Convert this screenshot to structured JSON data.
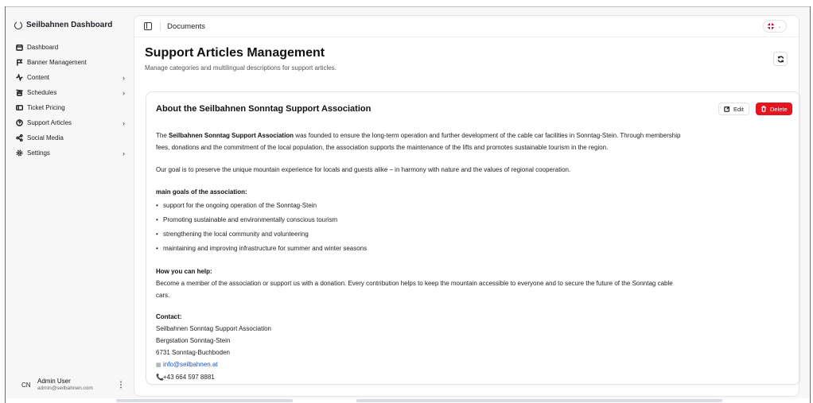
{
  "app": {
    "brand": "Seilbahnen Dashboard"
  },
  "sidebar": {
    "items": [
      {
        "label": "Dashboard",
        "icon": "calendar-icon",
        "has_children": false
      },
      {
        "label": "Banner Management",
        "icon": "flag-icon",
        "has_children": false
      },
      {
        "label": "Content",
        "icon": "activity-icon",
        "has_children": true
      },
      {
        "label": "Schedules",
        "icon": "cable-car-icon",
        "has_children": true
      },
      {
        "label": "Ticket Pricing",
        "icon": "ticket-icon",
        "has_children": false
      },
      {
        "label": "Support Articles",
        "icon": "help-circle-icon",
        "has_children": true
      },
      {
        "label": "Social Media",
        "icon": "share-icon",
        "has_children": false
      },
      {
        "label": "Settings",
        "icon": "gear-icon",
        "has_children": true
      }
    ],
    "chevron": "›",
    "user": {
      "initials": "CN",
      "name": "Admin User",
      "email": "admin@seilbahnen.com",
      "menu_glyph": "⋮"
    }
  },
  "header": {
    "breadcrumb": "Documents",
    "lang_chevron": "⌄"
  },
  "page": {
    "title": "Support Articles Management",
    "subtitle": "Manage categories and multilingual descriptions for support articles."
  },
  "article": {
    "title": "About the Seilbahnen Sonntag Support Association",
    "edit_label": "Edit",
    "delete_label": "Delete",
    "intro_bold": "Seilbahnen Sonntag Support Association",
    "intro_prefix": "The ",
    "intro_rest_1": " was founded to ensure the long-term operation and further development of the cable car facilities in Sonntag-Stein. Through membership",
    "intro_rest_2": "fees, donations and the commitment of the local population, the association supports the maintenance of the lifts and promotes sustainable tourism in the region.",
    "goal_text": "Our goal is to preserve the unique mountain experience for locals and guests alike – in harmony with nature and the values of regional cooperation.",
    "goals_heading": "main goals of the association:",
    "goals": [
      "support for the ongoing operation of the Sonntag-Stein",
      "Promoting sustainable and environmentally conscious tourism",
      "strengthening the local community and volunteering",
      "maintaining and improving infrastructure for summer and winter seasons"
    ],
    "help_heading": "How you can help:",
    "help_line_1": "Become a member of the association or support us with a donation. Every contribution helps to keep the mountain accessible to everyone and to secure the future of the Sonntag cable",
    "help_line_2": "cars.",
    "contact_heading": "Contact:",
    "contact_lines": [
      "Seilbahnen Sonntag Support Association",
      "Bergstation Sonntag-Stein",
      "6731 Sonntag-Buchboden"
    ],
    "email": "info@seilbahnen.at",
    "email_icon": "▦",
    "phone": "+43 664 597 8881",
    "phone_icon": "📞"
  },
  "colors": {
    "accent_red": "#e5141f",
    "link_blue": "#1a56c9"
  }
}
